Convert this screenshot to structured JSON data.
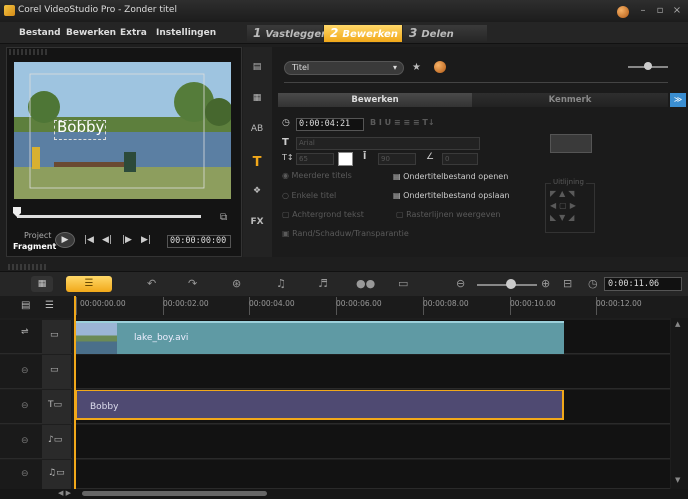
{
  "window": {
    "title": "Corel VideoStudio Pro - Zonder titel",
    "controls": [
      "–",
      "▫",
      "×"
    ]
  },
  "menu": [
    "Bestand",
    "Bewerken",
    "Extra",
    "Instellingen"
  ],
  "steps": [
    {
      "num": "1",
      "label": "Vastleggen"
    },
    {
      "num": "2",
      "label": "Bewerken",
      "active": true
    },
    {
      "num": "3",
      "label": "Delen"
    }
  ],
  "preview": {
    "overlay_text": "Bobby",
    "project_label": "Project",
    "fragment_label": "Fragment",
    "timecode": "00:00:00:00"
  },
  "options": {
    "title_dropdown": "Titel",
    "tabs": [
      "Bewerken",
      "Kenmerk"
    ],
    "duration": "0:00:04:21",
    "font": "Arial",
    "size_value": "65",
    "line_spacing": "90",
    "angle": "0",
    "multiple_titles": "Meerdere titels",
    "single_title": "Enkele titel",
    "text_background": "Achtergrond tekst",
    "safe_area": "Rasterlijnen weergeven",
    "border_shadow": "Rand/Schaduw/Transparantie",
    "open_subtitle": "Ondertitelbestand openen",
    "save_subtitle": "Ondertitelbestand opslaan",
    "alignment_label": "Uitlijning"
  },
  "toolbar": {
    "timecode": "0:00:11.06"
  },
  "ruler": [
    "00:00:00.00",
    "00:00:02.00",
    "00:00:04.00",
    "00:00:06.00",
    "00:00:08.00",
    "00:00:10.00",
    "00:00:12.00"
  ],
  "tracks": {
    "video_clip": "lake_boy.avi",
    "title_clip": "Bobby"
  },
  "colors": {
    "accent": "#f1a81a",
    "video_clip": "#5f9aa4",
    "title_clip": "#4f4a72",
    "background": "#1e1e1e"
  }
}
